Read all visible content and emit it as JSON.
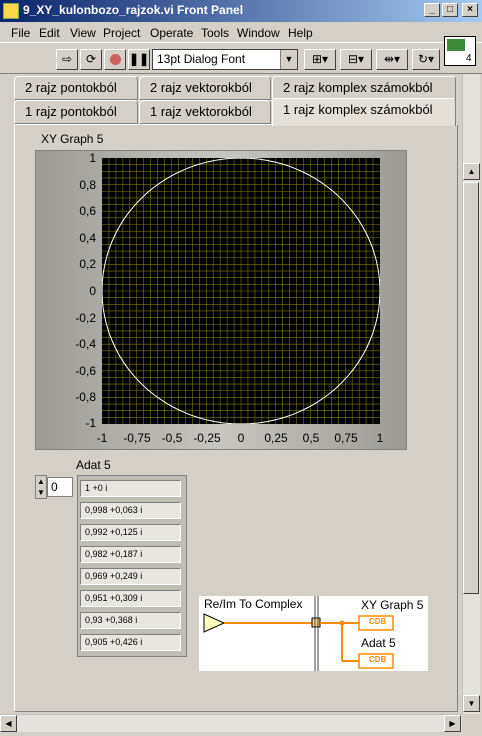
{
  "window": {
    "title": "9_XY_kulonbozo_rajzok.vi Front Panel",
    "minimize": "_",
    "maximize": "□",
    "close": "×"
  },
  "menu": [
    "File",
    "Edit",
    "View",
    "Project",
    "Operate",
    "Tools",
    "Window",
    "Help"
  ],
  "toolbar": {
    "font": "13pt Dialog Font",
    "vi_icon_number": "4"
  },
  "tabs": {
    "row1": [
      "2 rajz pontokból",
      "2 rajz vektorokból",
      "2 rajz komplex számokból"
    ],
    "row2": [
      "1 rajz pontokból",
      "1 rajz vektorokból",
      "1 rajz komplex számokból"
    ],
    "active": "1 rajz komplex számokból"
  },
  "graph": {
    "title": "XY Graph 5",
    "yticks": [
      "1",
      "0,8",
      "0,6",
      "0,4",
      "0,2",
      "0",
      "-0,2",
      "-0,4",
      "-0,6",
      "-0,8",
      "-1"
    ],
    "xticks": [
      "-1",
      "-0,75",
      "-0,5",
      "-0,25",
      "0",
      "0,25",
      "0,5",
      "0,75",
      "1"
    ],
    "colors": {
      "background": "#000000",
      "grid": "#7a7a10",
      "trace": "#ffffff"
    }
  },
  "chart_data": {
    "type": "line",
    "series": [
      {
        "shape": "unit circle",
        "points": 100
      }
    ],
    "xlim": [
      -1,
      1
    ],
    "ylim": [
      -1,
      1
    ],
    "grid": true
  },
  "array": {
    "label": "Adat 5",
    "index": "0",
    "values": [
      "1 +0 i",
      "0,998 +0,063 i",
      "0,992 +0,125 i",
      "0,982 +0,187 i",
      "0,969 +0,249 i",
      "0,951 +0,309 i",
      "0,93 +0,368 i",
      "0,905 +0,426 i"
    ]
  },
  "diagram": {
    "function": "Re/Im To Complex",
    "out1": "XY Graph 5",
    "out2": "Adat 5",
    "terminal": "CDB",
    "wire_color": "#ff8c00"
  }
}
